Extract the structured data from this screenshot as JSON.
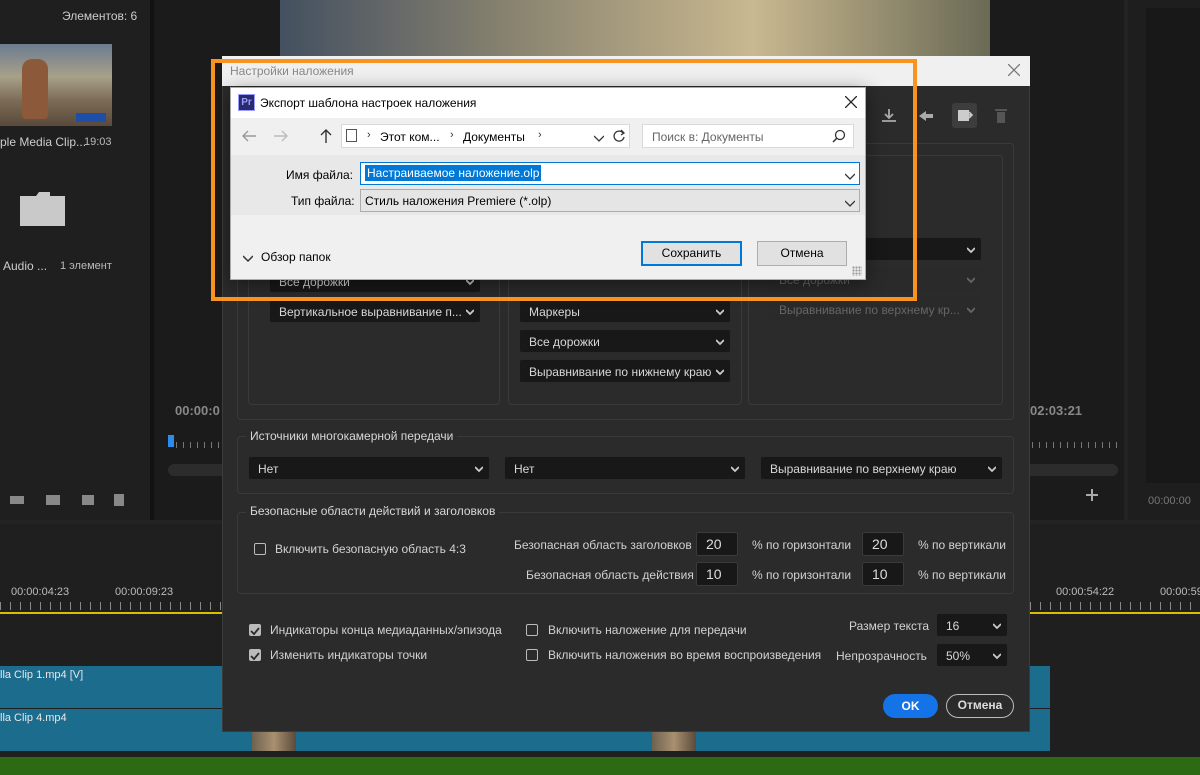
{
  "project": {
    "items_count": "Элементов: 6",
    "clip1_name": "ple Media Clip...",
    "clip1_duration": "19:03",
    "folder_name": "Audio ...",
    "folder_count": "1 элемент"
  },
  "monitor": {
    "timecode_left": "00:00:0",
    "timecode_right": "02:03:21",
    "timecode_right_small": "00:00:00"
  },
  "timeline": {
    "ticks": [
      "00:00:04:23",
      "00:00:09:23",
      "00:00:54:22",
      "00:00:59"
    ],
    "clip_v_label": "lla Clip 1.mp4 [V]",
    "clip_4_label": "lla Clip 4.mp4"
  },
  "overlay": {
    "title": "Настройки наложения",
    "col1": {
      "dd1": "Все дорожки",
      "dd2": "Вертикальное выравнивание п..."
    },
    "col2": {
      "dd1": "Маркеры",
      "dd2": "Все дорожки",
      "dd3": "Выравнивание по нижнему краю"
    },
    "col3": {
      "dd1": "Все дорожки",
      "dd2": "Выравнивание по верхнему кр..."
    },
    "multicam": {
      "title": "Источники многокамерной передачи",
      "dd1": "Нет",
      "dd2": "Нет",
      "dd3": "Выравнивание по верхнему краю"
    },
    "safe": {
      "title": "Безопасные области действий и заголовков",
      "checkbox43": "Включить безопасную область 4:3",
      "title_area_label": "Безопасная область заголовков",
      "action_area_label": "Безопасная область действия",
      "title_h": "20",
      "title_v": "20",
      "action_h": "10",
      "action_v": "10",
      "pct_h": "% по горизонтали",
      "pct_v": "% по вертикали"
    },
    "options": {
      "end_indicators": "Индикаторы конца медиаданных/эпизода",
      "change_point": "Изменить индикаторы точки",
      "overlay_playback": "Включить наложение для передачи",
      "overlay_during": "Включить наложения во время воспроизведения",
      "text_size_label": "Размер текста",
      "text_size": "16",
      "opacity_label": "Непрозрачность",
      "opacity": "50%"
    },
    "ok": "OK",
    "cancel": "Отмена"
  },
  "save_dialog": {
    "title": "Экспорт шаблона настроек наложения",
    "breadcrumb": [
      "Этот ком...",
      "Документы"
    ],
    "search_placeholder": "Поиск в: Документы",
    "filename_label": "Имя файла:",
    "filename_value": "Настраиваемое наложение.olp",
    "filetype_label": "Тип файла:",
    "filetype_value": "Стиль наложения Premiere (*.olp)",
    "browse_folders": "Обзор папок",
    "save": "Сохранить",
    "cancel": "Отмена"
  },
  "colors": {
    "highlight": "#f7931e",
    "accent": "#1473e6",
    "selection": "#0078d7"
  }
}
